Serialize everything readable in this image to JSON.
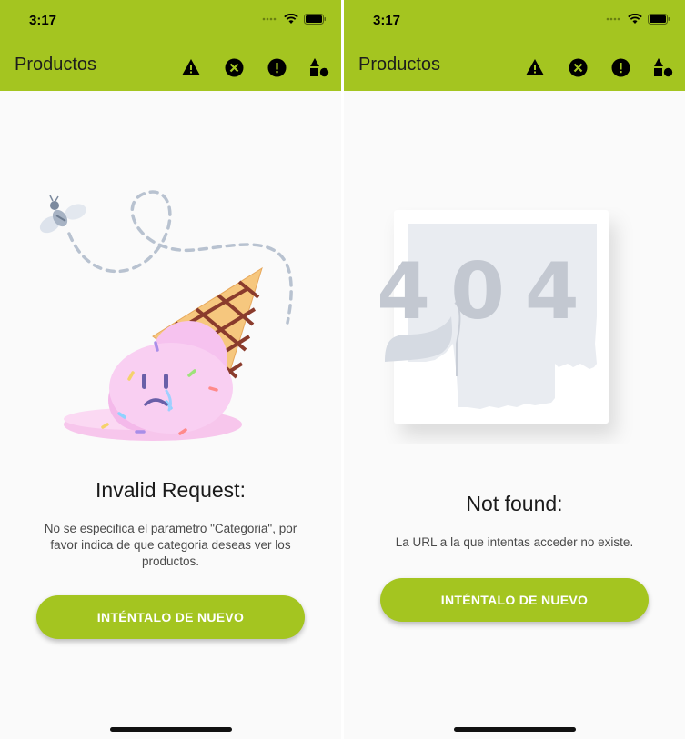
{
  "screens": [
    {
      "status_time": "3:17",
      "app_title": "Productos",
      "actions": [
        {
          "icon": "warning-triangle-icon"
        },
        {
          "icon": "cancel-circle-icon"
        },
        {
          "icon": "error-circle-icon"
        },
        {
          "icon": "category-shapes-icon"
        }
      ],
      "illustration": "melted-ice-cream-icon",
      "heading": "Invalid Request:",
      "message": "No se especifica el parametro \"Categoria\", por favor indica de que categoria deseas ver los productos.",
      "button": "INTÉNTALO DE NUEVO"
    },
    {
      "status_time": "3:17",
      "app_title": "Productos",
      "actions": [
        {
          "icon": "warning-triangle-icon"
        },
        {
          "icon": "cancel-circle-icon"
        },
        {
          "icon": "error-circle-icon"
        },
        {
          "icon": "category-shapes-icon"
        }
      ],
      "illustration": "404-icon",
      "illustration_text": "404",
      "heading": "Not found:",
      "message": "La URL a la que intentas acceder no existe.",
      "button": "INTÉNTALO DE NUEVO"
    }
  ],
  "colors": {
    "accent": "#a4c520",
    "background": "#fafafa"
  }
}
